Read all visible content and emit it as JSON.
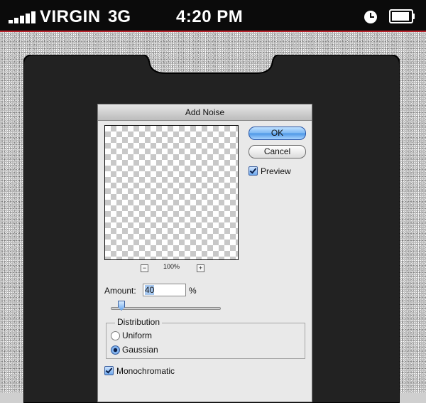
{
  "statusbar": {
    "carrier": "VIRGIN",
    "network": "3G",
    "time": "4:20 PM",
    "icons": [
      "signal-bars-icon",
      "alarm-clock-icon",
      "battery-icon"
    ],
    "accent_color": "#b8242c"
  },
  "dialog": {
    "title": "Add Noise",
    "ok_label": "OK",
    "cancel_label": "Cancel",
    "preview_label": "Preview",
    "preview_checked": true,
    "zoom_out": "−",
    "zoom_level": "100%",
    "zoom_in": "+",
    "amount_label": "Amount:",
    "amount_value": "40",
    "amount_unit": "%",
    "amount_slider_fraction": 0.1,
    "distribution_label": "Distribution",
    "distribution_options": [
      "Uniform",
      "Gaussian"
    ],
    "distribution_selected": "Gaussian",
    "monochromatic_label": "Monochromatic",
    "monochromatic_checked": true
  }
}
